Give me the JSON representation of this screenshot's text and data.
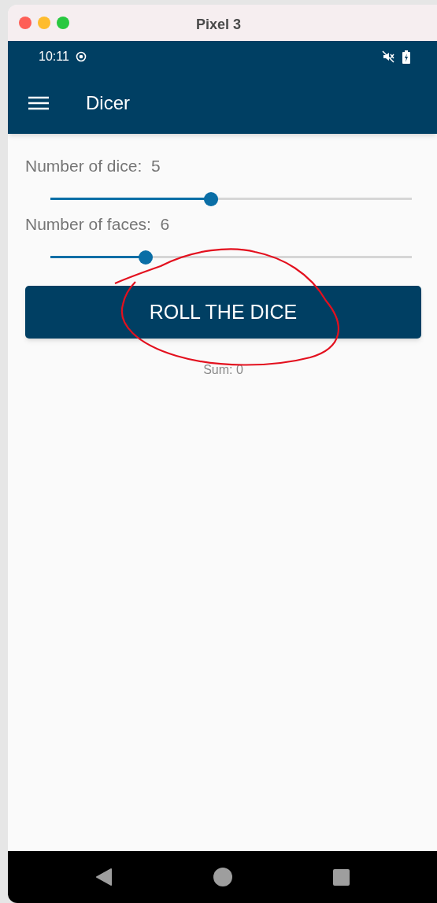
{
  "window": {
    "title": "Pixel 3"
  },
  "status_bar": {
    "time": "10:11"
  },
  "app_bar": {
    "title": "Dicer"
  },
  "sliders": [
    {
      "label": "Number of dice:  5",
      "level": 0.444
    },
    {
      "label": "Number of faces:  6",
      "level": 0.264
    }
  ],
  "button": {
    "label": "ROLL THE DICE"
  },
  "result": "Sum: 0"
}
